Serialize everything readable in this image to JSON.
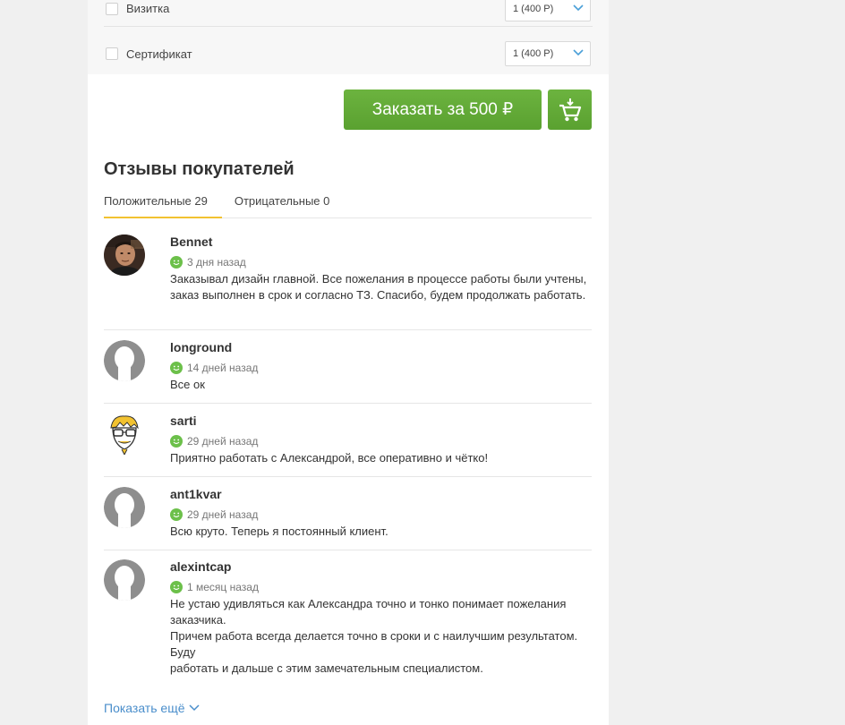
{
  "options": [
    {
      "label": "Визитка",
      "select_value": "1 (400 Р)"
    },
    {
      "label": "Сертификат",
      "select_value": "1 (400 Р)"
    }
  ],
  "order": {
    "button_label": "Заказать за 500 ₽",
    "cart_icon": "cart-add-icon"
  },
  "reviews_section": {
    "title": "Отзывы покупателей",
    "tabs": [
      {
        "label": "Положительные 29",
        "active": true
      },
      {
        "label": "Отрицательные 0",
        "active": false
      }
    ]
  },
  "reviews": [
    {
      "name": "Bennet",
      "time": "3 дня назад",
      "avatar": "photo",
      "text": "Заказывал дизайн главной. Все пожелания в процессе работы были учтены, заказ выполнен в срок и согласно ТЗ. Спасибо, будем продолжать работать."
    },
    {
      "name": "longround",
      "time": "14 дней назад",
      "avatar": "default",
      "text": "Все ок"
    },
    {
      "name": "sarti",
      "time": "29 дней назад",
      "avatar": "cartoon",
      "text": "Приятно работать с Александрой, все оперативно и чётко!"
    },
    {
      "name": "ant1kvar",
      "time": "29 дней назад",
      "avatar": "default",
      "text": "Всю круто. Теперь я постоянный клиент."
    },
    {
      "name": "alexintcap",
      "time": "1 месяц назад",
      "avatar": "default",
      "text_lines": [
        "Не устаю удивляться как Александра точно и тонко понимает пожелания заказчика.",
        "Причем работа всегда делается точно в сроки и с наилучшим результатом. Буду",
        "работать и дальше с этим замечательным специалистом."
      ]
    }
  ],
  "show_more": {
    "label": "Показать ещё"
  },
  "colors": {
    "accent_green": "#5aa130",
    "tab_underline": "#f2c230",
    "link": "#4a8ecb",
    "positive": "#6cc04a"
  }
}
